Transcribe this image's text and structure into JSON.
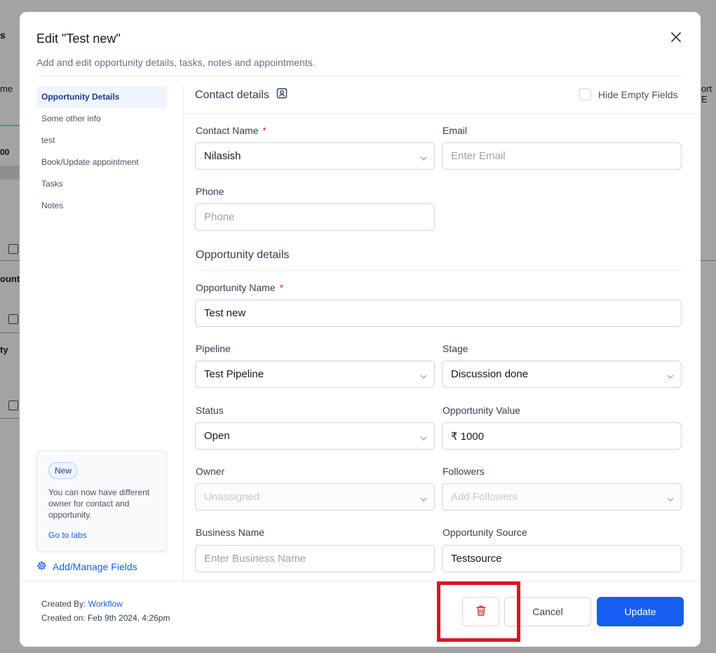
{
  "background": {
    "fragments": [
      "s",
      "me",
      "00",
      "ount",
      "ty",
      "ort E"
    ]
  },
  "modal": {
    "title": "Edit \"Test new\"",
    "subtitle": "Add and edit opportunity details, tasks, notes and appointments."
  },
  "sidebar": {
    "items": [
      {
        "label": "Opportunity Details"
      },
      {
        "label": "Some other info"
      },
      {
        "label": "test"
      },
      {
        "label": "Book/Update appointment"
      },
      {
        "label": "Tasks"
      },
      {
        "label": "Notes"
      }
    ],
    "labs": {
      "badge": "New",
      "text": "You can now have different owner for contact and opportunity.",
      "link": "Go to labs"
    },
    "manage_fields": "Add/Manage Fields"
  },
  "contact": {
    "section_title": "Contact details",
    "hide_empty_label": "Hide Empty Fields",
    "contact_name_label": "Contact Name",
    "contact_name_value": "Nilasish",
    "email_label": "Email",
    "email_placeholder": "Enter Email",
    "phone_label": "Phone",
    "phone_placeholder": "Phone"
  },
  "opportunity": {
    "section_title": "Opportunity details",
    "name_label": "Opportunity Name",
    "name_value": "Test new",
    "pipeline_label": "Pipeline",
    "pipeline_value": "Test Pipeline",
    "stage_label": "Stage",
    "stage_value": "Discussion done",
    "status_label": "Status",
    "status_value": "Open",
    "value_label": "Opportunity Value",
    "value_value": "₹ 1000",
    "owner_label": "Owner",
    "owner_placeholder": "Unassigned",
    "followers_label": "Followers",
    "followers_placeholder": "Add Followers",
    "business_label": "Business Name",
    "business_placeholder": "Enter Business Name",
    "source_label": "Opportunity Source",
    "source_value": "Testsource"
  },
  "footer": {
    "created_by_label": "Created By:",
    "created_by_value": "Workflow",
    "created_on": "Created on: Feb 9th 2024, 4:26pm",
    "cancel_label": "Cancel",
    "update_label": "Update"
  },
  "colors": {
    "primary": "#155eef",
    "danger": "#d92d20",
    "highlight": "#e0141e"
  }
}
